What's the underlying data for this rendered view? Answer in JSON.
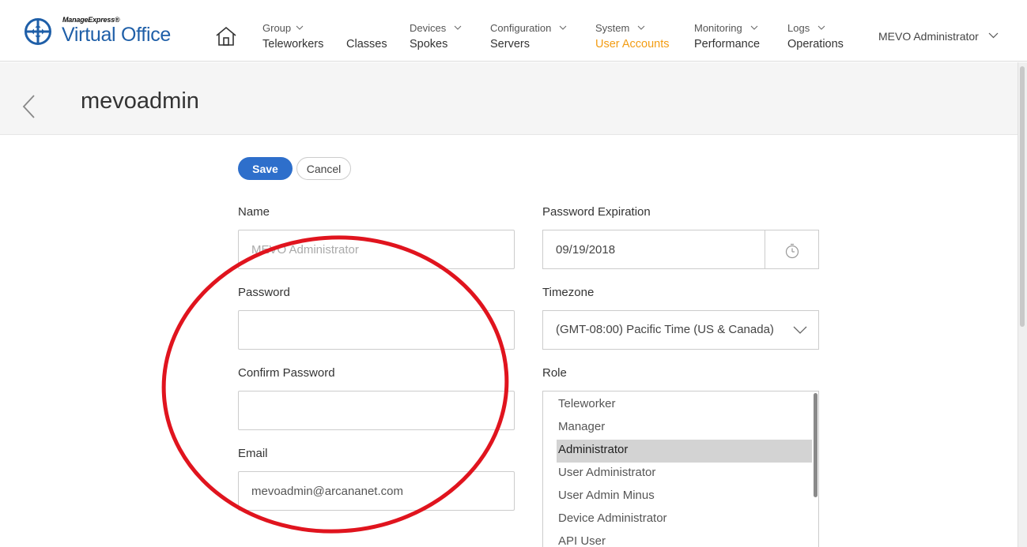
{
  "brand": {
    "small": "ManageExpress®",
    "name": "Virtual Office"
  },
  "nav": [
    {
      "top": "Group",
      "main": "Teleworkers",
      "has_menu": true
    },
    {
      "top": "",
      "main": "Classes",
      "has_menu": false
    },
    {
      "top": "Devices",
      "main": "Spokes",
      "has_menu": true
    },
    {
      "top": "Configuration",
      "main": "Servers",
      "has_menu": true
    },
    {
      "top": "System",
      "main": "User Accounts",
      "has_menu": true,
      "active": true
    },
    {
      "top": "Monitoring",
      "main": "Performance",
      "has_menu": true
    },
    {
      "top": "Logs",
      "main": "Operations",
      "has_menu": true
    }
  ],
  "user_menu": "MEVO Administrator",
  "page_title": "mevoadmin",
  "buttons": {
    "save": "Save",
    "cancel": "Cancel"
  },
  "form": {
    "name": {
      "label": "Name",
      "value": "MEVO Administrator"
    },
    "password": {
      "label": "Password",
      "value": ""
    },
    "confirm_password": {
      "label": "Confirm Password",
      "value": ""
    },
    "email": {
      "label": "Email",
      "value": "mevoadmin@arcananet.com"
    },
    "password_expiration": {
      "label": "Password Expiration",
      "value": "09/19/2018"
    },
    "timezone": {
      "label": "Timezone",
      "value": "(GMT-08:00) Pacific Time (US & Canada)"
    },
    "role": {
      "label": "Role",
      "options": [
        "Teleworker",
        "Manager",
        "Administrator",
        "User Administrator",
        "User Admin Minus",
        "Device Administrator",
        "API User"
      ],
      "selected": "Administrator"
    }
  },
  "colors": {
    "brand_blue": "#1f5fa8",
    "active_nav": "#f39c12",
    "save_button": "#2e6fcb",
    "annotation": "#e0141e"
  },
  "icons": [
    "logo-icon",
    "home-icon",
    "chevron-down-icon",
    "back-arrow-icon",
    "timer-icon"
  ]
}
